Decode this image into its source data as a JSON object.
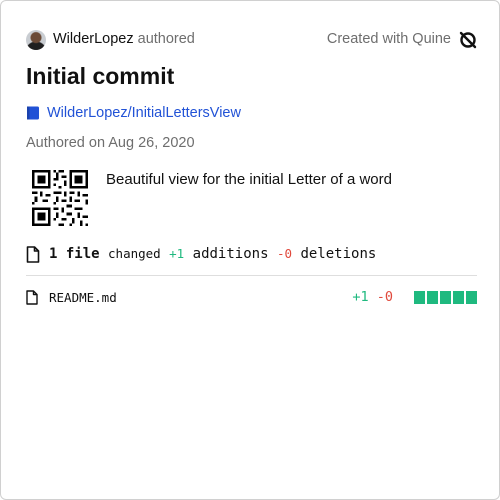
{
  "header": {
    "author_name": "WilderLopez",
    "authored_label": "authored",
    "created_label": "Created with Quine"
  },
  "commit": {
    "title": "Initial commit",
    "repo": "WilderLopez/InitialLettersView",
    "date_label": "Authored on Aug 26, 2020",
    "message": "Beautiful view for the initial Letter of a word"
  },
  "stats": {
    "files_count": "1 file",
    "changed_label": "changed",
    "additions": "+1",
    "additions_label": "additions",
    "deletions": "-0",
    "deletions_label": "deletions"
  },
  "files": [
    {
      "name": "README.md",
      "additions": "+1",
      "deletions": "-0",
      "blocks": 5
    }
  ],
  "colors": {
    "link": "#2152d6",
    "addition": "#1fb97f",
    "deletion": "#e0493c"
  },
  "icons": {
    "brand": "quine-logo-icon",
    "repo": "repo-book-icon",
    "file": "file-icon"
  }
}
